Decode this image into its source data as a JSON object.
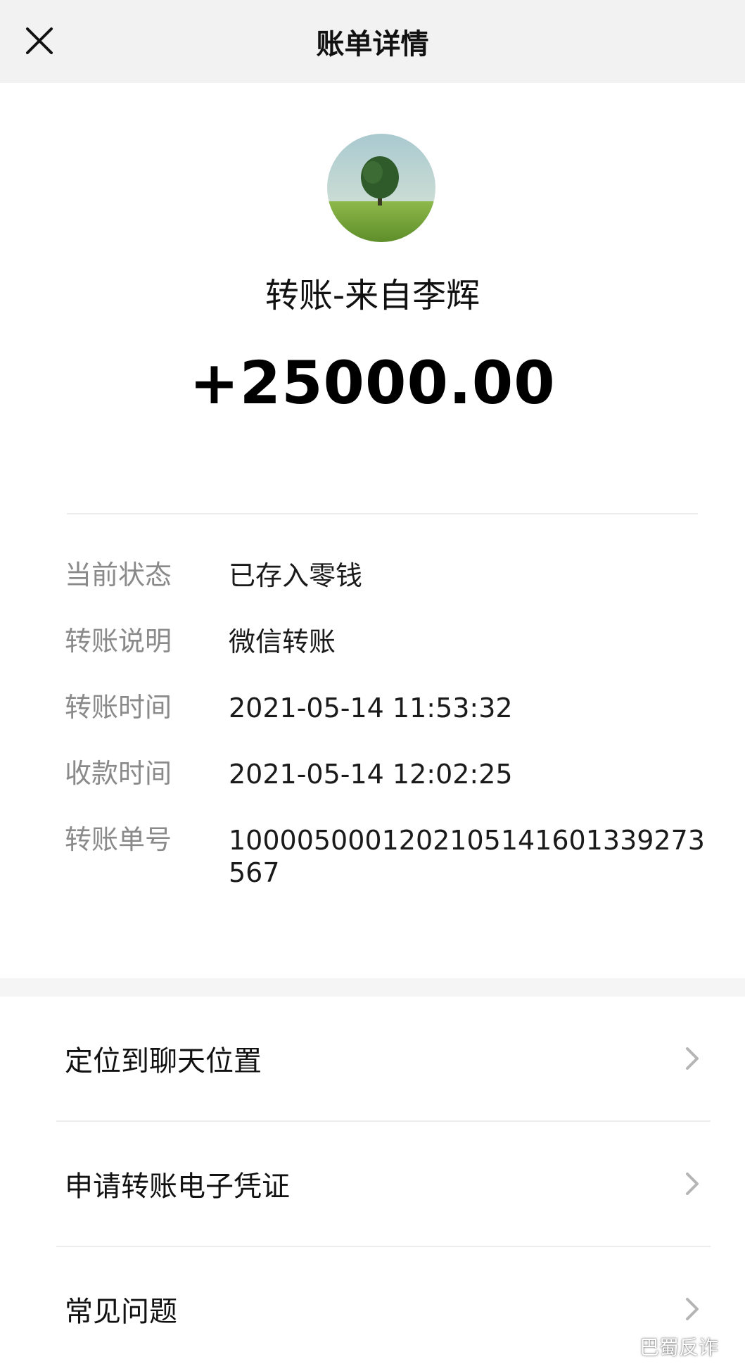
{
  "header": {
    "title": "账单详情",
    "close_icon": "close-icon"
  },
  "transfer": {
    "payer_label": "转账-来自李辉",
    "amount": "+25000.00"
  },
  "details": [
    {
      "label": "当前状态",
      "value": "已存入零钱"
    },
    {
      "label": "转账说明",
      "value": "微信转账"
    },
    {
      "label": "转账时间",
      "value": "2021-05-14 11:53:32"
    },
    {
      "label": "收款时间",
      "value": "2021-05-14 12:02:25"
    },
    {
      "label": "转账单号",
      "value": "1000050001202105141601339273567"
    }
  ],
  "menu": [
    {
      "label": "定位到聊天位置"
    },
    {
      "label": "申请转账电子凭证"
    },
    {
      "label": "常见问题"
    }
  ],
  "watermark": {
    "text": "巴蜀反诈",
    "icon": "wechat-icon"
  },
  "colors": {
    "header_bg": "#f2f2f2",
    "label_gray": "#8a8a8a",
    "divider": "#ececec"
  }
}
